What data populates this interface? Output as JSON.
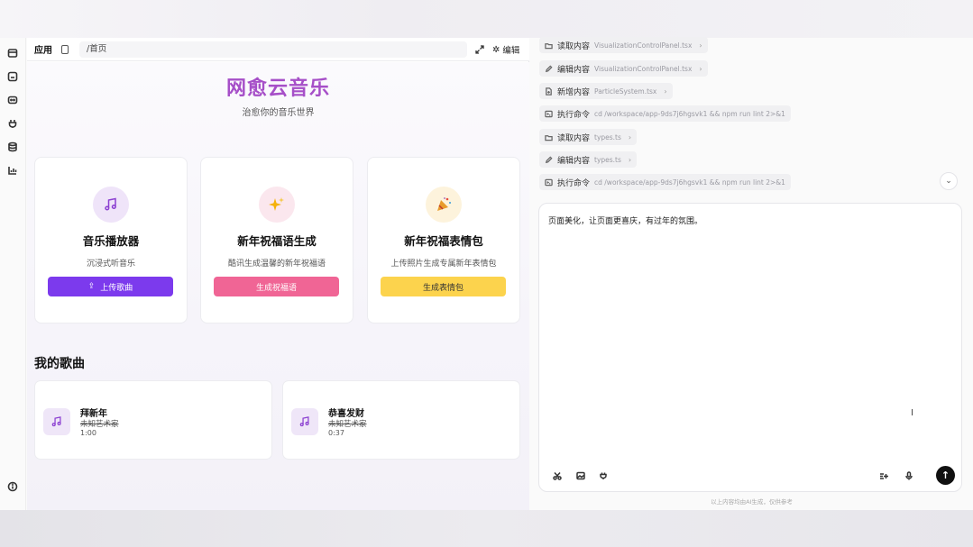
{
  "toolbar": {
    "app_tab": "应用",
    "url": "/首页",
    "edit_label": "编辑"
  },
  "preview": {
    "brand_title": "网愈云音乐",
    "tagline": "治愈你的音乐世界",
    "features": [
      {
        "title": "音乐播放器",
        "desc": "沉浸式听音乐",
        "button": "上传歌曲",
        "icon": "music-note-icon",
        "button_color": "#7c3aed"
      },
      {
        "title": "新年祝福语生成",
        "desc": "酷讯生成温馨的新年祝福语",
        "button": "生成祝福语",
        "icon": "sparkles-icon",
        "button_color": "#f06595"
      },
      {
        "title": "新年祝福表情包",
        "desc": "上传照片生成专属新年表情包",
        "button": "生成表情包",
        "icon": "party-popper-icon",
        "button_color": "#fcd34d"
      }
    ],
    "section_title": "我的歌曲",
    "songs": [
      {
        "name": "拜新年",
        "artist": "未知艺术家",
        "duration": "1:00"
      },
      {
        "name": "恭喜发财",
        "artist": "未知艺术家",
        "duration": "0:37"
      }
    ]
  },
  "log": [
    {
      "action": "读取内容",
      "meta": "VisualizationControlPanel.tsx",
      "icon": "folder-icon"
    },
    {
      "action": "编辑内容",
      "meta": "VisualizationControlPanel.tsx",
      "icon": "pencil-icon"
    },
    {
      "action": "新增内容",
      "meta": "ParticleSystem.tsx",
      "icon": "file-plus-icon"
    },
    {
      "action": "执行命令",
      "meta": "cd /workspace/app-9ds7j6hgsvk1 && npm run lint 2>&1",
      "icon": "terminal-icon"
    },
    {
      "action": "读取内容",
      "meta": "types.ts",
      "icon": "folder-icon"
    },
    {
      "action": "编辑内容",
      "meta": "types.ts",
      "icon": "pencil-icon"
    },
    {
      "action": "执行命令",
      "meta": "cd /workspace/app-9ds7j6hgsvk1 && npm run lint 2>&1",
      "icon": "terminal-icon"
    }
  ],
  "chat": {
    "message": "页面美化，让页面更喜庆，有过年的氛围。",
    "disclaimer": "以上内容均由AI生成，仅供参考"
  },
  "colors": {
    "brand": "#a64fc8",
    "accent_purple": "#7c3aed",
    "accent_pink": "#f06595",
    "accent_yellow": "#fcd34d"
  }
}
